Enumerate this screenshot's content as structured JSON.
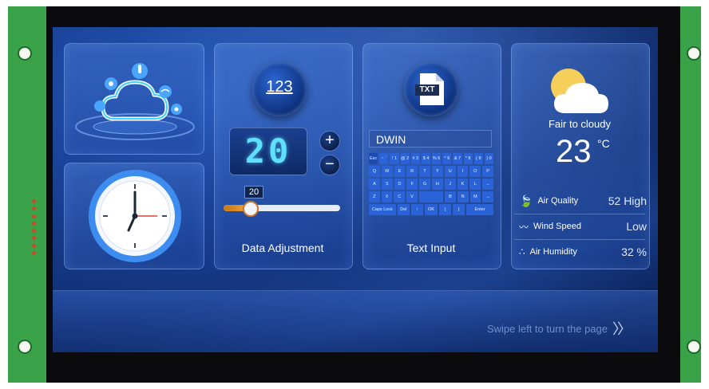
{
  "colors": {
    "accent": "#2a62d8",
    "digits": "#5ee0ff",
    "slider": "#f2a13a",
    "board": "#2f8f3c"
  },
  "numeric_card": {
    "icon_text": "123",
    "display_value": "20",
    "plus_label": "+",
    "minus_label": "−",
    "slider_value": "20",
    "slider_fraction": 0.22,
    "caption": "Data Adjustment"
  },
  "text_card": {
    "icon_text": "TXT",
    "input_value": "DWIN",
    "caption": "Text Input",
    "keyboard": [
      [
        "Esc",
        "~ `",
        "! 1",
        "@ 2",
        "# 3",
        "$ 4",
        "% 5",
        "^ 6",
        "& 7",
        "* 8",
        "( 9",
        ") 0"
      ],
      [
        "Q",
        "W",
        "E",
        "R",
        "T",
        "Y",
        "U",
        "I",
        "O",
        "P"
      ],
      [
        "A",
        "S",
        "D",
        "F",
        "G",
        "H",
        "J",
        "K",
        "L",
        "←"
      ],
      [
        "Z",
        "X",
        "C",
        "V",
        "",
        "B",
        "N",
        "M",
        "→"
      ],
      [
        "Caps Lock",
        "Del",
        "↑",
        "OK",
        "{",
        "}",
        "Enter"
      ]
    ]
  },
  "weather_card": {
    "condition": "Fair to cloudy",
    "temperature": "23",
    "unit": "°C",
    "air_quality_label": "Air Quality",
    "air_quality_value": "52 High",
    "wind_label": "Wind Speed",
    "wind_value": "Low",
    "humidity_label": "Air Humidity",
    "humidity_value": "32 %"
  },
  "footer": {
    "swipe_hint": "Swipe left to turn the page",
    "swipe_arrows": "〉〉"
  }
}
